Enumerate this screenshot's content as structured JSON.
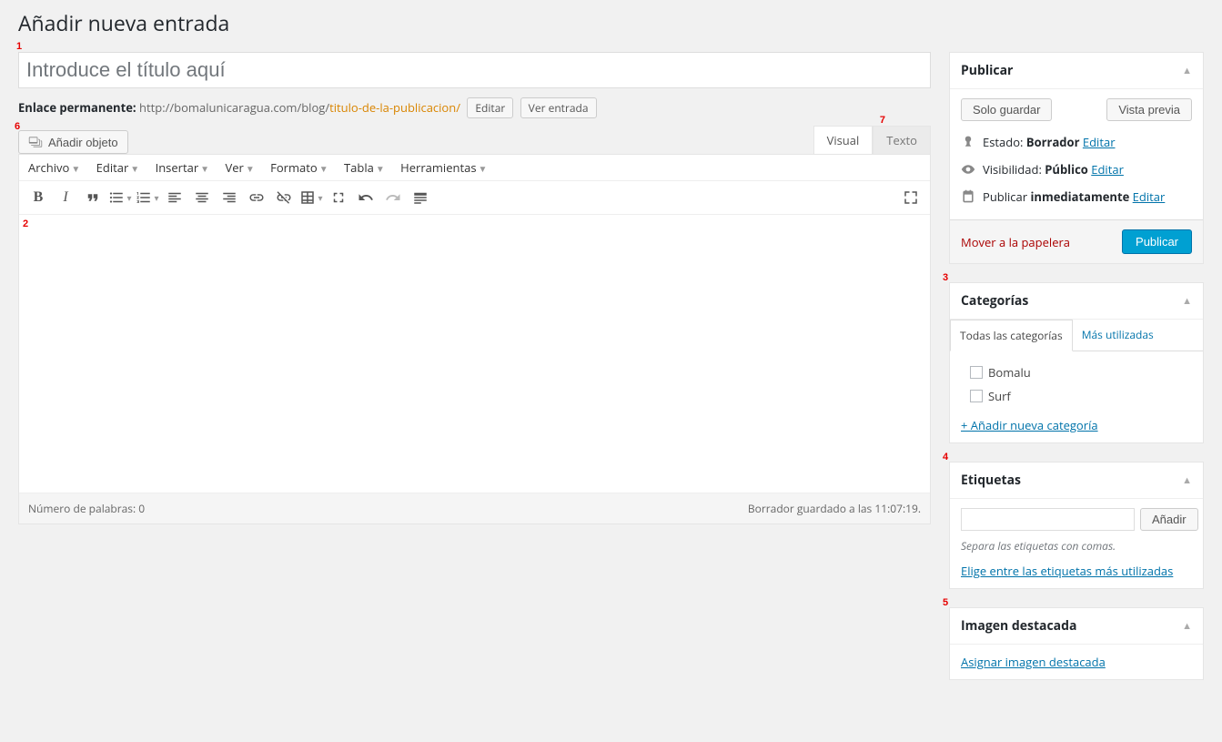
{
  "page_title": "Añadir nueva entrada",
  "title_placeholder": "Introduce el título aquí",
  "permalink": {
    "label": "Enlace permanente:",
    "base": "http://bomalunicaragua.com/blog/",
    "slug": "titulo-de-la-publicacion/",
    "edit": "Editar",
    "view": "Ver entrada"
  },
  "add_media": "Añadir objeto",
  "editor_tabs": {
    "visual": "Visual",
    "text": "Texto"
  },
  "menu": [
    "Archivo",
    "Editar",
    "Insertar",
    "Ver",
    "Formato",
    "Tabla",
    "Herramientas"
  ],
  "word_count_label": "Número de palabras: ",
  "word_count": "0",
  "draft_saved": "Borrador guardado a las 11:07:19.",
  "publish": {
    "title": "Publicar",
    "save_draft": "Solo guardar",
    "preview": "Vista previa",
    "status_label": "Estado:",
    "status_value": "Borrador",
    "visibility_label": "Visibilidad:",
    "visibility_value": "Público",
    "schedule_label": "Publicar",
    "schedule_value": "inmediatamente",
    "edit": "Editar",
    "trash": "Mover a la papelera",
    "publish_btn": "Publicar"
  },
  "categories": {
    "title": "Categorías",
    "tab_all": "Todas las categorías",
    "tab_most": "Más utilizadas",
    "items": [
      "Bomalu",
      "Surf"
    ],
    "add_new": "+ Añadir nueva categoría"
  },
  "tags": {
    "title": "Etiquetas",
    "add": "Añadir",
    "hint": "Separa las etiquetas con comas.",
    "choose": "Elige entre las etiquetas más utilizadas"
  },
  "featured": {
    "title": "Imagen destacada",
    "assign": "Asignar imagen destacada"
  },
  "badges": {
    "b1": "1",
    "b2": "2",
    "b3": "3",
    "b4": "4",
    "b5": "5",
    "b6": "6",
    "b7": "7"
  }
}
